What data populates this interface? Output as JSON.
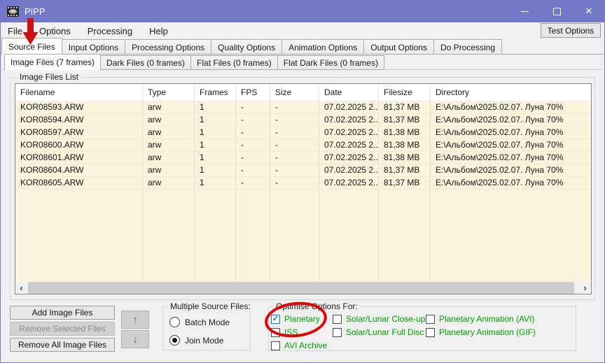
{
  "titlebar": {
    "title": "PIPP"
  },
  "menubar": {
    "items": [
      "File",
      "Options",
      "Processing",
      "Help"
    ],
    "test_options": "Test Options"
  },
  "tabs_main": {
    "items": [
      {
        "label": "Source Files",
        "selected": true
      },
      {
        "label": "Input Options",
        "selected": false
      },
      {
        "label": "Processing Options",
        "selected": false
      },
      {
        "label": "Quality Options",
        "selected": false
      },
      {
        "label": "Animation Options",
        "selected": false
      },
      {
        "label": "Output Options",
        "selected": false
      },
      {
        "label": "Do Processing",
        "selected": false
      }
    ]
  },
  "tabs_files": {
    "items": [
      {
        "label": "Image Files (7 frames)",
        "selected": true
      },
      {
        "label": "Dark Files (0 frames)",
        "selected": false
      },
      {
        "label": "Flat Files (0 frames)",
        "selected": false
      },
      {
        "label": "Flat Dark Files (0 frames)",
        "selected": false
      }
    ]
  },
  "file_list": {
    "group_title": "Image Files List",
    "columns": [
      "Filename",
      "Type",
      "Frames",
      "FPS",
      "Size",
      "Date",
      "Filesize",
      "Directory"
    ],
    "rows": [
      {
        "filename": "KOR08593.ARW",
        "type": "arw",
        "frames": "1",
        "fps": "-",
        "size": "-",
        "date": "07.02.2025 2...",
        "filesize": "81,37 MB",
        "directory": "E:\\Альбом\\2025.02.07. Луна 70%"
      },
      {
        "filename": "KOR08594.ARW",
        "type": "arw",
        "frames": "1",
        "fps": "-",
        "size": "-",
        "date": "07.02.2025 2...",
        "filesize": "81,37 MB",
        "directory": "E:\\Альбом\\2025.02.07. Луна 70%"
      },
      {
        "filename": "KOR08597.ARW",
        "type": "arw",
        "frames": "1",
        "fps": "-",
        "size": "-",
        "date": "07.02.2025 2...",
        "filesize": "81,38 MB",
        "directory": "E:\\Альбом\\2025.02.07. Луна 70%"
      },
      {
        "filename": "KOR08600.ARW",
        "type": "arw",
        "frames": "1",
        "fps": "-",
        "size": "-",
        "date": "07.02.2025 2...",
        "filesize": "81,38 MB",
        "directory": "E:\\Альбом\\2025.02.07. Луна 70%"
      },
      {
        "filename": "KOR08601.ARW",
        "type": "arw",
        "frames": "1",
        "fps": "-",
        "size": "-",
        "date": "07.02.2025 2...",
        "filesize": "81,38 MB",
        "directory": "E:\\Альбом\\2025.02.07. Луна 70%"
      },
      {
        "filename": "KOR08604.ARW",
        "type": "arw",
        "frames": "1",
        "fps": "-",
        "size": "-",
        "date": "07.02.2025 2...",
        "filesize": "81,37 MB",
        "directory": "E:\\Альбом\\2025.02.07. Луна 70%"
      },
      {
        "filename": "KOR08605.ARW",
        "type": "arw",
        "frames": "1",
        "fps": "-",
        "size": "-",
        "date": "07.02.2025 2...",
        "filesize": "81,37 MB",
        "directory": "E:\\Альбом\\2025.02.07. Луна 70%"
      }
    ]
  },
  "actions": {
    "add": "Add Image Files",
    "remove_selected": "Remove Selected Files",
    "remove_all": "Remove All Image Files"
  },
  "multiple_source": {
    "title": "Multiple Source Files:",
    "options": [
      {
        "label": "Batch Mode",
        "selected": false
      },
      {
        "label": "Join Mode",
        "selected": true
      }
    ]
  },
  "optimise": {
    "title": "Optimise Options For:",
    "columns": [
      {
        "items": [
          {
            "label": "Planetary",
            "checked": true
          },
          {
            "label": "ISS",
            "checked": false
          },
          {
            "label": "AVI Archive",
            "checked": false
          }
        ]
      },
      {
        "items": [
          {
            "label": "Solar/Lunar Close-up",
            "checked": false
          },
          {
            "label": "Solar/Lunar Full Disc",
            "checked": false
          }
        ]
      },
      {
        "items": [
          {
            "label": "Planetary Animation (AVI)",
            "checked": false
          },
          {
            "label": "Planetary Animation (GIF)",
            "checked": false
          }
        ]
      }
    ]
  },
  "icons": {
    "check": "✓",
    "move_up": "↑",
    "move_down": "↓",
    "scroll_left": "‹",
    "scroll_right": "›",
    "close": "✕"
  },
  "colors": {
    "titlebar": "#7478C8",
    "list_row_bg": "#FBF3DC",
    "optimise_green": "#00A000",
    "check_blue": "#0078D7",
    "annotation_red": "#E00000"
  }
}
